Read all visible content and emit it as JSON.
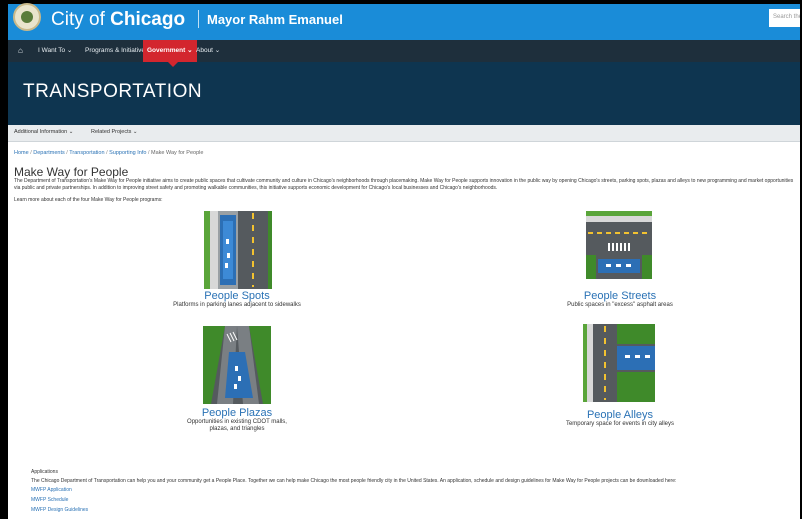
{
  "header": {
    "city_prefix": "City of ",
    "city_name": "Chicago",
    "mayor": "Mayor Rahm Emanuel",
    "search_placeholder": "Search the"
  },
  "nav": {
    "home_icon": "home-icon",
    "items": [
      {
        "label": "I Want To ⌄"
      },
      {
        "label": "Programs & Initiatives ⌄"
      },
      {
        "label": "Government ⌄"
      },
      {
        "label": "About ⌄"
      }
    ]
  },
  "banner": {
    "title": "TRANSPORTATION"
  },
  "subnav": {
    "items": [
      {
        "label": "Additional Information ⌄"
      },
      {
        "label": "Related Projects ⌄"
      }
    ]
  },
  "breadcrumb": {
    "items": [
      "Home",
      "Departments",
      "Transportation",
      "Supporting Info",
      "Make Way for People"
    ],
    "separator": "/"
  },
  "page": {
    "title": "Make Way for People",
    "intro": "The Department of Transportation's Make Way for People initiative aims to create public spaces that cultivate community and culture in Chicago's neighborhoods through placemaking.  Make Way for People supports innovation in the public way by opening Chicago's streets, parking spots, plazas and alleys to new programming and market opportunities via public and private partnerships. In addition to improving street safety and promoting walkable communities, this initiative supports economic development for Chicago's local businesses and Chicago's neighborhoods.",
    "learn_more": "Learn more about each of the four Make Way for People programs:"
  },
  "programs": [
    {
      "title": "People Spots",
      "desc": "Platforms in parking lanes adjacent to sidewalks",
      "icon": "people-spots-icon"
    },
    {
      "title": "People Streets",
      "desc": "Public spaces in \"excess\" asphalt areas",
      "icon": "people-streets-icon"
    },
    {
      "title": "People Plazas",
      "desc_line1": "Opportunities in existing CDOT malls,",
      "desc_line2": "plazas, and triangles",
      "icon": "people-plazas-icon"
    },
    {
      "title": "People Alleys",
      "desc": "Temporary space for events in city alleys",
      "icon": "people-alleys-icon"
    }
  ],
  "applications": {
    "label": "Applications",
    "text": "The Chicago Department of Transportation can help you and your community get a People Place. Together we can help make Chicago the most people friendly city in the United States.  An application, schedule and design guidelines for Make Way for People projects can be downloaded here:",
    "links": [
      "MWFP Application",
      "MWFP Schedule",
      "MWFP Design Guidelines"
    ]
  },
  "colors": {
    "topbar": "#1a8cd8",
    "nav": "#1e2f3c",
    "nav_active": "#d3262e",
    "banner": "#0e3550",
    "link": "#2a72b5"
  }
}
